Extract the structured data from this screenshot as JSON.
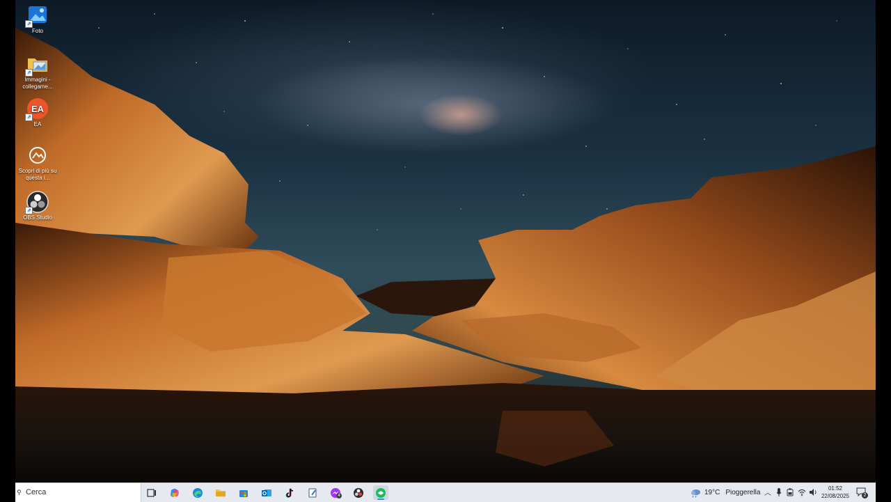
{
  "desktop_icons": [
    {
      "label": "Foto",
      "icon": "photos-icon"
    },
    {
      "label": "Immagini - collegame...",
      "icon": "folder-icon"
    },
    {
      "label": "EA",
      "icon": "ea-icon"
    },
    {
      "label": "Scopri di più su questa i...",
      "icon": "spotlight-icon"
    },
    {
      "label": "OBS Studio",
      "icon": "obs-icon"
    }
  ],
  "taskbar": {
    "search_placeholder": "Cerca",
    "apps": [
      {
        "name": "task-view",
        "icon": "task-view-icon"
      },
      {
        "name": "copilot",
        "icon": "copilot-icon"
      },
      {
        "name": "edge",
        "icon": "edge-icon"
      },
      {
        "name": "file-explorer",
        "icon": "folder-icon"
      },
      {
        "name": "microsoft-store",
        "icon": "store-icon"
      },
      {
        "name": "outlook",
        "icon": "outlook-icon"
      },
      {
        "name": "tiktok",
        "icon": "tiktok-icon"
      },
      {
        "name": "notepad",
        "icon": "notepad-icon"
      },
      {
        "name": "messenger",
        "icon": "messenger-icon",
        "badge": "4"
      },
      {
        "name": "obs-studio",
        "icon": "obs-icon"
      },
      {
        "name": "active-app",
        "icon": "green-app-icon",
        "active": true
      }
    ],
    "weather": {
      "temp": "19°C",
      "condition": "Pioggerella",
      "icon": "rain-cloud-icon"
    },
    "clock": {
      "time": "01:52",
      "date": "22/08/2025"
    },
    "notifications": {
      "count": "2"
    }
  },
  "colors": {
    "taskbar": "#e6eaf0",
    "active_indicator": "#3a8dde"
  }
}
